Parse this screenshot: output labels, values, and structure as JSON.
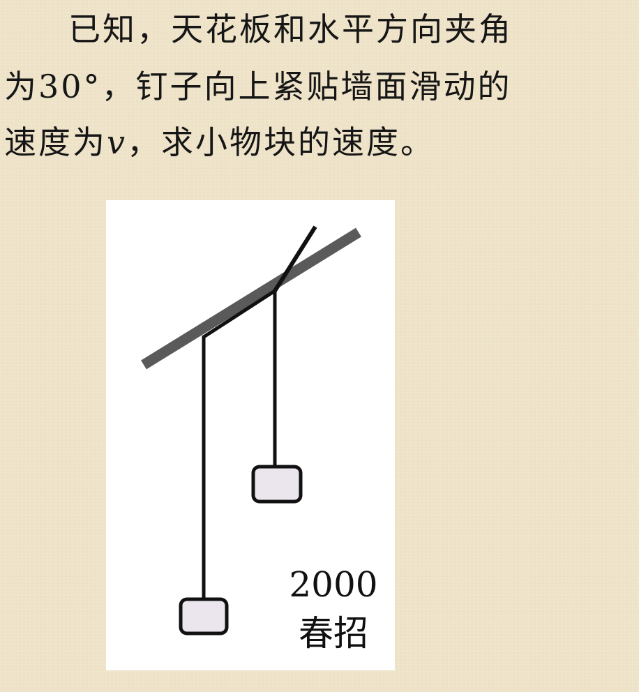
{
  "problem": {
    "line1": "已知，天花板和水平方向夹角",
    "line2": "为30°，钉子向上紧贴墙面滑动的",
    "line3_before": "速度为",
    "line3_var": "v",
    "line3_after": "，求小物块的速度。"
  },
  "figure": {
    "label_year": "2000",
    "label_term": "春招"
  },
  "colors": {
    "background": "#efe4c8",
    "panel": "#ffffff",
    "ceiling": "#5a5a5a",
    "string": "#111111",
    "block_fill": "#ebe6ee"
  }
}
